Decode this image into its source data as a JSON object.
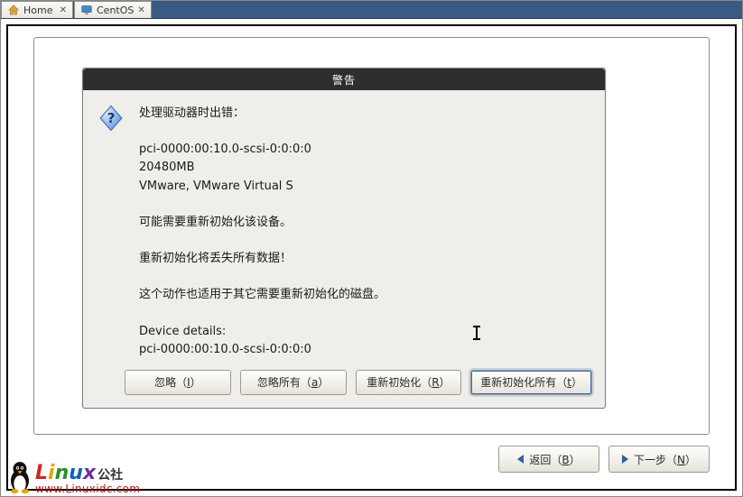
{
  "tabs": [
    {
      "label": "Home",
      "icon": "home-icon"
    },
    {
      "label": "CentOS",
      "icon": "monitor-icon"
    }
  ],
  "dialog": {
    "title": "警告",
    "message": "处理驱动器时出错：\n\npci-0000:00:10.0-scsi-0:0:0:0\n20480MB\nVMware, VMware Virtual S\n\n可能需要重新初始化该设备。\n\n重新初始化将丢失所有数据！\n\n这个动作也适用于其它需要重新初始化的磁盘。\n\nDevice details:\npci-0000:00:10.0-scsi-0:0:0:0",
    "buttons": {
      "ignore": "忽略（I）",
      "ignore_all": "忽略所有（a）",
      "reinit": "重新初始化（R）",
      "reinit_all": "重新初始化所有（t）"
    },
    "icon": "question-icon"
  },
  "nav": {
    "back": "返回（B）",
    "next": "下一步（N）"
  },
  "watermark": {
    "brand_cn": "公社",
    "url": "www.Linuxidc.com"
  }
}
